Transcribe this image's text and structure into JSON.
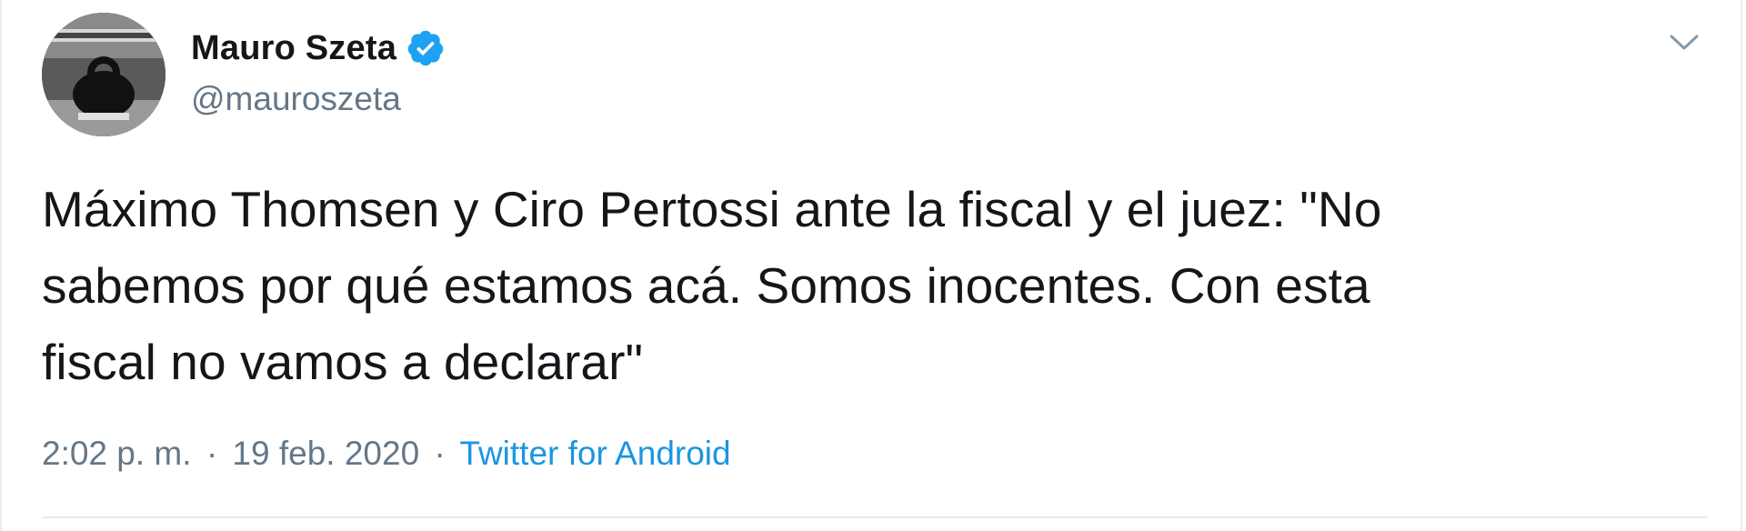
{
  "author": {
    "display_name": "Mauro Szeta",
    "handle": "@mauroszeta",
    "verified": true,
    "avatar_icon": "avatar-photo-padlock"
  },
  "tweet": {
    "text": "Máximo Thomsen y Ciro Pertossi ante la fiscal y el juez: \"No\nsabemos por qué estamos acá. Somos inocentes. Con esta\nfiscal no vamos a declarar\""
  },
  "meta": {
    "time": "2:02 p. m.",
    "separator": "·",
    "date": "19 feb. 2020",
    "source": "Twitter for Android"
  },
  "icons": {
    "verified": "verified-badge-icon",
    "menu": "chevron-down-icon"
  },
  "colors": {
    "accent": "#1da1f2",
    "link": "#1b95e0",
    "secondary_text": "#657786",
    "primary_text": "#14171a",
    "border": "#e6ecf0"
  }
}
